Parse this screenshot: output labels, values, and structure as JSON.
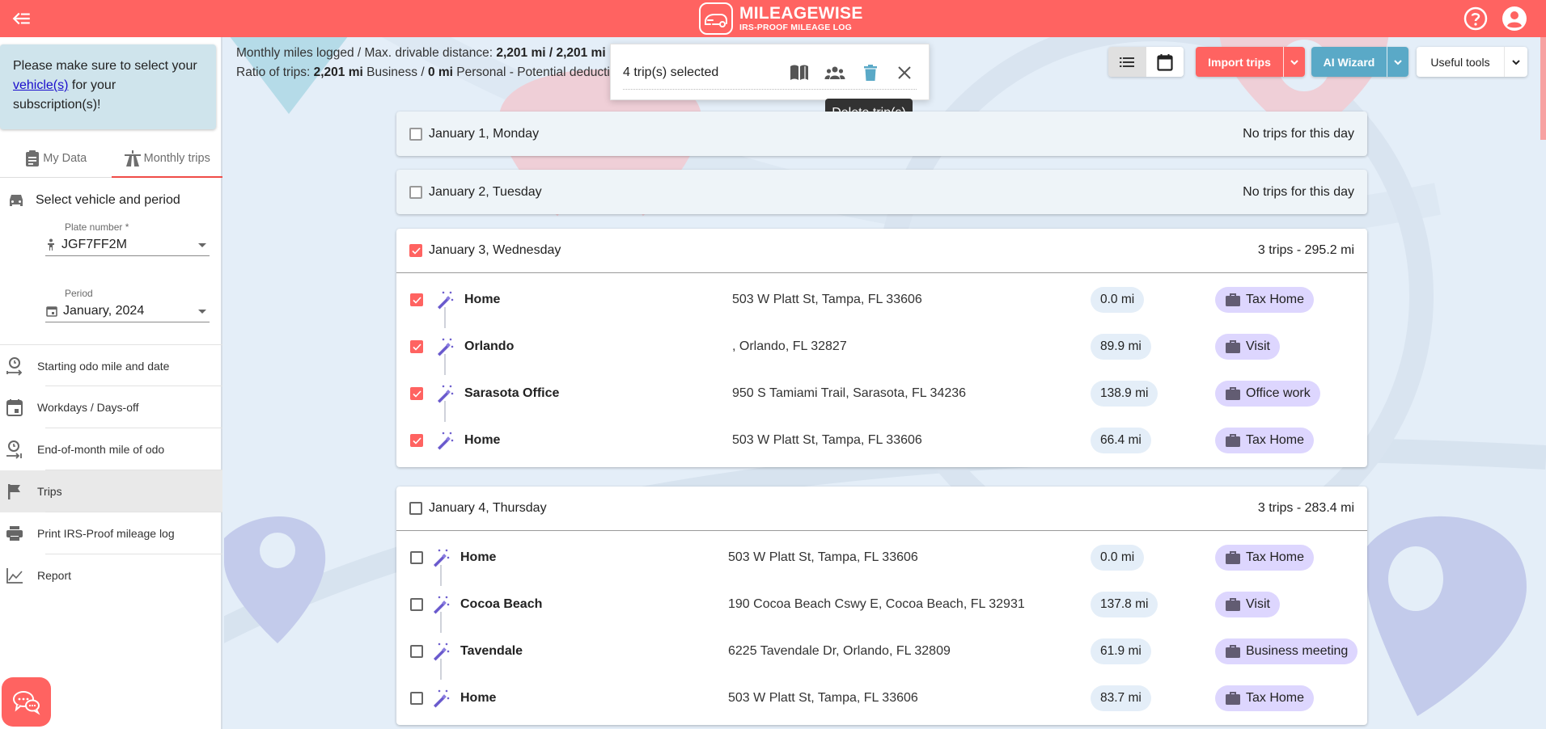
{
  "header": {
    "logo_title": "MILEAGEWISE",
    "logo_subtitle": "IRS-PROOF MILEAGE LOG",
    "brand_color": "#ff6361"
  },
  "sidebar": {
    "notice": {
      "before": "Please make sure to select your ",
      "link": "vehicle(s)",
      "after": " for your subscription(s)!"
    },
    "tabs": [
      {
        "label": "My Data",
        "icon": "clipboard-icon",
        "active": false
      },
      {
        "label": "Monthly trips",
        "icon": "road-icon",
        "active": true
      }
    ],
    "select_title": "Select vehicle and period",
    "plate": {
      "label": "Plate number *",
      "value": "JGF7FF2M"
    },
    "period": {
      "label": "Period",
      "value": "January, 2024"
    },
    "menu": [
      {
        "label": "Starting odo mile and date",
        "icon": "odo-start-icon"
      },
      {
        "label": "Workdays / Days-off",
        "icon": "calendar-icon"
      },
      {
        "label": "End-of-month mile of odo",
        "icon": "odo-end-icon"
      },
      {
        "label": "Trips",
        "icon": "flag-icon",
        "active": true
      },
      {
        "label": "Print IRS-Proof mileage log",
        "icon": "print-icon"
      },
      {
        "label": "Report",
        "icon": "chart-line-icon"
      }
    ]
  },
  "stats": {
    "line1_label": "Monthly miles logged / Max. drivable distance: ",
    "line1_value": "2,201 mi / 2,201 mi",
    "line2_label": "Ratio of trips: ",
    "line2_business": "2,201 mi",
    "line2_business_label": " Business / ",
    "line2_personal": "0 mi",
    "line2_rest": " Personal - Potential deduction"
  },
  "selection": {
    "count_text": "4 trip(s) selected",
    "tooltip": "Delete trip(s)"
  },
  "toolbar": {
    "import_label": "Import trips",
    "ai_label": "AI Wizard",
    "tools_label": "Useful tools",
    "import_color": "#ff6361",
    "ai_color": "#5aa9c7"
  },
  "days": [
    {
      "title": "January 1, Monday",
      "summary": "No trips for this day",
      "checked": false,
      "trips": []
    },
    {
      "title": "January 2, Tuesday",
      "summary": "No trips for this day",
      "checked": false,
      "trips": []
    },
    {
      "title": "January 3, Wednesday",
      "summary": "3 trips - 295.2 mi",
      "checked": true,
      "trips": [
        {
          "location": "Home",
          "address": "503 W Platt St, Tampa, FL 33606",
          "distance": "0.0 mi",
          "purpose": "Tax Home",
          "checked": true
        },
        {
          "location": "Orlando",
          "address": ", Orlando, FL 32827",
          "distance": "89.9 mi",
          "purpose": "Visit",
          "checked": true
        },
        {
          "location": "Sarasota Office",
          "address": "950 S Tamiami Trail, Sarasota, FL 34236",
          "distance": "138.9 mi",
          "purpose": "Office work",
          "checked": true
        },
        {
          "location": "Home",
          "address": "503 W Platt St, Tampa, FL 33606",
          "distance": "66.4 mi",
          "purpose": "Tax Home",
          "checked": true
        }
      ]
    },
    {
      "title": "January 4, Thursday",
      "summary": "3 trips - 283.4 mi",
      "checked": false,
      "trips": [
        {
          "location": "Home",
          "address": "503 W Platt St, Tampa, FL 33606",
          "distance": "0.0 mi",
          "purpose": "Tax Home",
          "checked": false
        },
        {
          "location": "Cocoa Beach",
          "address": "190 Cocoa Beach Cswy E, Cocoa Beach, FL 32931",
          "distance": "137.8 mi",
          "purpose": "Visit",
          "checked": false
        },
        {
          "location": "Tavendale",
          "address": "6225 Tavendale Dr, Orlando, FL 32809",
          "distance": "61.9 mi",
          "purpose": "Business meeting",
          "checked": false
        },
        {
          "location": "Home",
          "address": "503 W Platt St, Tampa, FL 33606",
          "distance": "83.7 mi",
          "purpose": "Tax Home",
          "checked": false
        }
      ]
    }
  ]
}
